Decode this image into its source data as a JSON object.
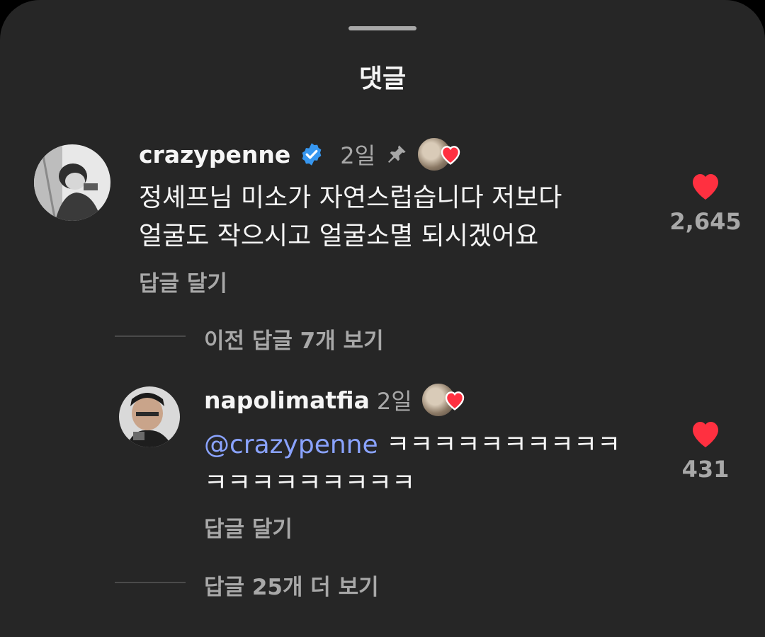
{
  "sheet": {
    "title": "댓글"
  },
  "comments": [
    {
      "username": "crazypenne",
      "time": "2일",
      "verified": true,
      "pinned": true,
      "text_lines": [
        "정셰프님 미소가 자연스럽습니다 저보다",
        "얼굴도 작으시고 얼굴소멸 되시겠어요"
      ],
      "likes": "2,645",
      "reply_label": "답글 달기"
    },
    {
      "username": "napolimatfia",
      "time": "2일",
      "mention": "@crazypenne",
      "text_first": "ㅋㅋㅋㅋㅋㅋㅋㅋㅋㅋ",
      "text_second": "ㅋㅋㅋㅋㅋㅋㅋㅋㅋ",
      "likes": "431",
      "reply_label": "답글 달기"
    }
  ],
  "threads": {
    "previous_replies": "이전 답글 7개 보기",
    "more_replies": "답글 25개 더 보기"
  },
  "colors": {
    "background": "#262626",
    "heart": "#ff3040",
    "verified": "#3797f0",
    "mention": "#8aa3ff",
    "secondary_text": "#a8a8a8"
  }
}
